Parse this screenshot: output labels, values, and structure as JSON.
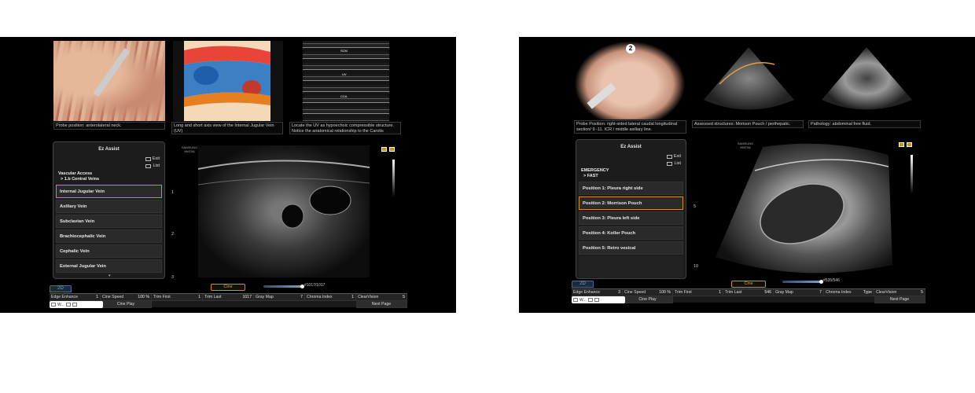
{
  "screen1": {
    "captions": [
      "Probe position: anterolateral neck.",
      "Long and short axis view of the Internal Jugular Vein (UV)",
      "Locate the UV as hypoechoic compressible structure. Notice the anatomical relationship to the Carotis"
    ],
    "image_labels": [
      "SCM",
      "UV",
      "CCA"
    ],
    "ez_assist": {
      "title": "Ez Assist",
      "exit": "Exit",
      "list": "List",
      "category": "Vascular Access",
      "subcategory": "> 1.b Central Veins",
      "items": [
        "Internal Jugular Vein",
        "Axillary Vein",
        "Subclavian Vein",
        "Brachiocephalic Vein",
        "Cephalic Vein",
        "External Jugular Vein"
      ],
      "selected": 0
    },
    "depth_marks": [
      "1",
      "2",
      "3"
    ],
    "logo": "SAMSUNG HM70A",
    "cine_label": "Cine",
    "frame_counter": "#1017/1017",
    "mode_tab": "2D",
    "bottom_row1": [
      {
        "label": "Edge Enhance",
        "value": "1"
      },
      {
        "label": "Cine Speed",
        "value": "100 %"
      },
      {
        "label": "Trim First",
        "value": "1"
      },
      {
        "label": "Trim Last",
        "value": "1017"
      },
      {
        "label": "Gray Map",
        "value": "7"
      },
      {
        "label": "Chroma Index",
        "value": "1"
      },
      {
        "label": "ClearVision",
        "value": "5"
      }
    ],
    "bottom_row2": [
      "Cine Play",
      "Next Page"
    ],
    "wbox_label": "W..."
  },
  "screen2": {
    "captions": [
      "Probe Position: right-sided lateral caudal longitudinal section/ 9 -11. ICR / middle axillary line.",
      "Assessed structures: Morison Pouch / perihepatic.",
      "Pathology: abdominal free fluid."
    ],
    "step_badge": "2",
    "ez_assist": {
      "title": "Ez Assist",
      "exit": "Exit",
      "list": "List",
      "category": "EMERGENCY",
      "subcategory": "> FAST",
      "items": [
        "Position 1: Pleura right side",
        "Position 2: Morrison Pouch",
        "Position 3: Pleura left side",
        "Position 4: Koller Pouch",
        "Position 5: Retro vesical"
      ],
      "selected": 1
    },
    "depth_marks": [
      "5",
      "10"
    ],
    "logo": "SAMSUNG HM70A",
    "cine_label": "Cine",
    "frame_counter": "#535/546",
    "mode_tab": "2D",
    "bottom_row1": [
      {
        "label": "Edge Enhance",
        "value": "3"
      },
      {
        "label": "Cine Speed",
        "value": "100 %"
      },
      {
        "label": "Trim First",
        "value": "1"
      },
      {
        "label": "Trim Last",
        "value": "546"
      },
      {
        "label": "Gray Map",
        "value": "7"
      },
      {
        "label": "Chroma Index",
        "value": "Type"
      },
      {
        "label": "ClearVision",
        "value": "5"
      }
    ],
    "bottom_row2": [
      "Cine Play",
      "Next Page"
    ],
    "wbox_label": "W..."
  },
  "colors": {
    "accent": "#d4901c",
    "mode_tab": "#6fa0e0",
    "background": "#000000"
  },
  "icons": [
    "exit-icon",
    "list-icon",
    "probe-icon",
    "image-icon"
  ]
}
